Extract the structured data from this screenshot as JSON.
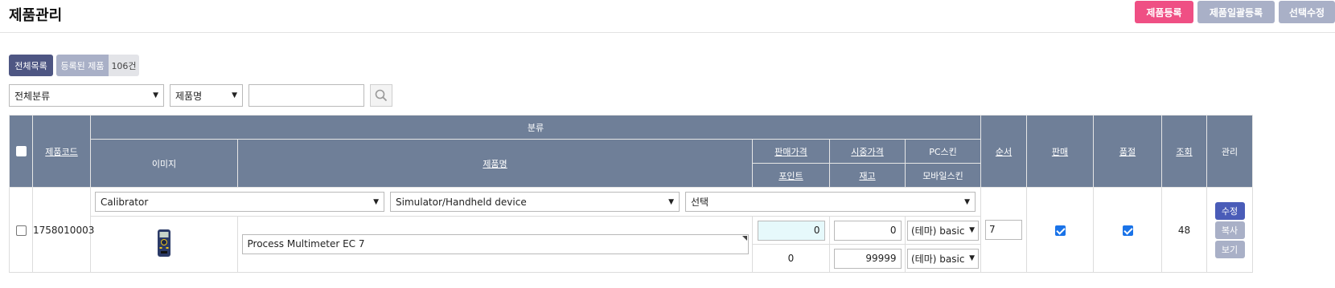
{
  "header": {
    "title": "제품관리",
    "actions": {
      "register": "제품등록",
      "bulk_register": "제품일괄등록",
      "bulk_edit": "선택수정"
    }
  },
  "tabs": {
    "all": "전체목록",
    "registered": "등록된 제품",
    "count": "106건"
  },
  "search": {
    "category_select": "전체분류",
    "field_select": "제품명",
    "query": ""
  },
  "table": {
    "headers": {
      "category": "분류",
      "code": "제품코드",
      "image": "이미지",
      "name": "제품명",
      "sale_price": "판매가격",
      "market_price": "시중가격",
      "pc_skin": "PC스킨",
      "point": "포인트",
      "stock": "재고",
      "mobile_skin": "모바일스킨",
      "order": "순서",
      "sale": "판매",
      "soldout": "품절",
      "views": "조회",
      "manage": "관리"
    },
    "rows": [
      {
        "category1": "Calibrator",
        "category2": "Simulator/Handheld device",
        "category3": "선택",
        "code": "1758010003",
        "name": "Process Multimeter EC 7",
        "sale_price": "0",
        "market_price": "0",
        "point": "0",
        "stock": "99999",
        "pc_skin": "(테마) basic",
        "mobile_skin": "(테마) basic",
        "order": "7",
        "sale": true,
        "soldout": true,
        "views": "48",
        "btn_edit": "수정",
        "btn_copy": "복사",
        "btn_view": "보기"
      }
    ]
  },
  "icons": {
    "search": "search-icon",
    "product_image": "multimeter-image"
  },
  "colors": {
    "pink": "#ef4f84",
    "gray": "#a9b0c7",
    "navy": "#4e5683",
    "header_bg": "#6f7f98",
    "edit_btn": "#4a5cb8"
  }
}
